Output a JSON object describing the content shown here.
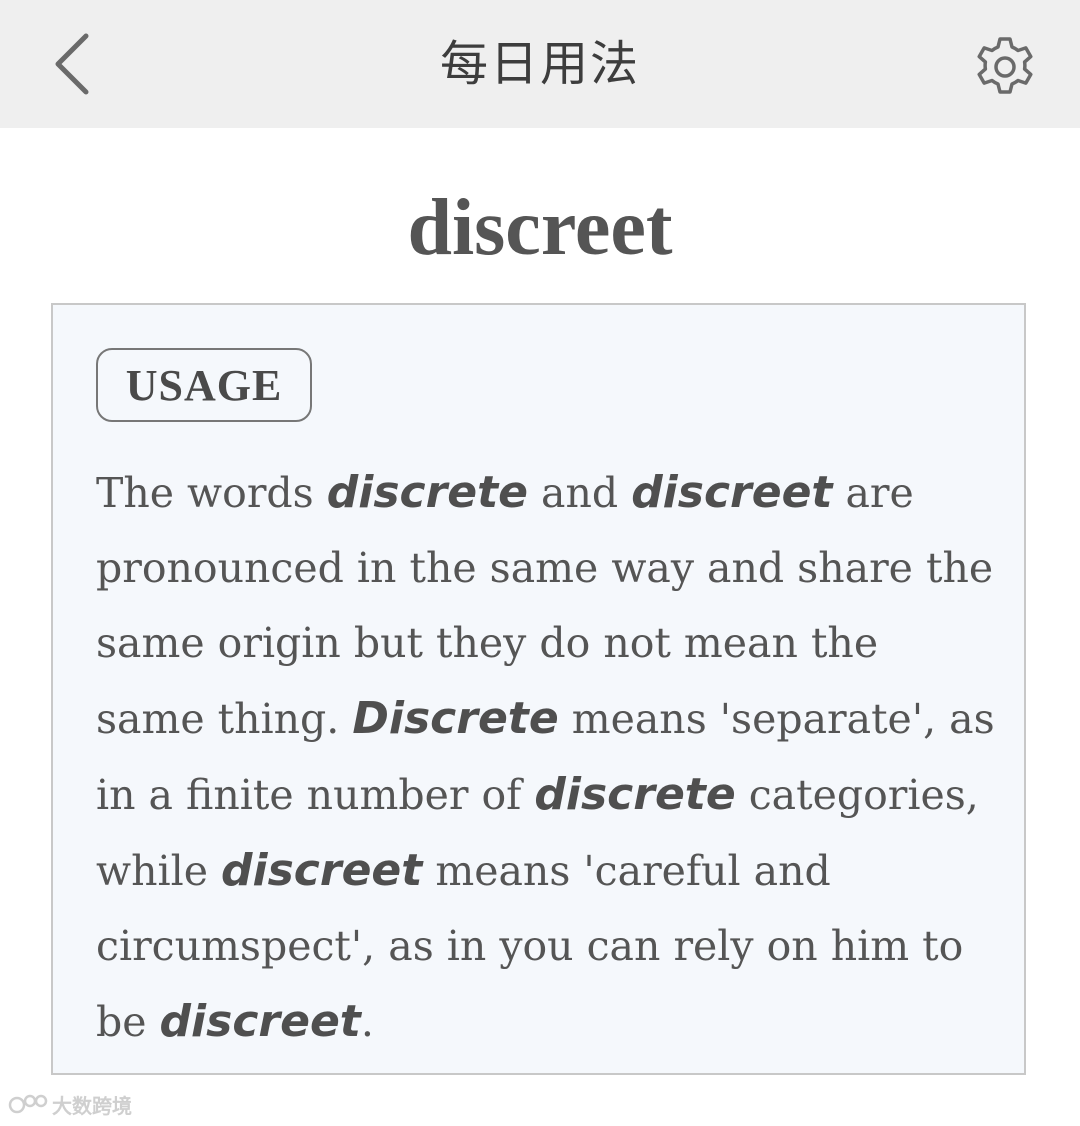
{
  "header": {
    "title": "每日用法",
    "back_icon": "chevron-left-icon",
    "settings_icon": "gear-icon"
  },
  "entry": {
    "headword": "discreet"
  },
  "usage": {
    "badge_label": "USAGE",
    "segments": [
      {
        "text": "The words ",
        "emphasis": false
      },
      {
        "text": "discrete",
        "emphasis": true
      },
      {
        "text": " and ",
        "emphasis": false
      },
      {
        "text": "discreet",
        "emphasis": true
      },
      {
        "text": " are pronounced in the same way and share the same origin but they do not mean the same thing. ",
        "emphasis": false
      },
      {
        "text": "Discrete",
        "emphasis": true
      },
      {
        "text": " means 'separate', as in a finite number of ",
        "emphasis": false
      },
      {
        "text": "discrete",
        "emphasis": true
      },
      {
        "text": " categories, while ",
        "emphasis": false
      },
      {
        "text": "discreet",
        "emphasis": true
      },
      {
        "text": " means 'careful and circumspect', as in you can rely on him to be ",
        "emphasis": false
      },
      {
        "text": "discreet",
        "emphasis": true
      },
      {
        "text": ".",
        "emphasis": false
      }
    ]
  },
  "watermark": {
    "text": "大数跨境"
  },
  "colors": {
    "header_bg": "#efefef",
    "card_bg": "#f5f8fc",
    "card_border": "#c8c8c8",
    "text": "#555555"
  }
}
